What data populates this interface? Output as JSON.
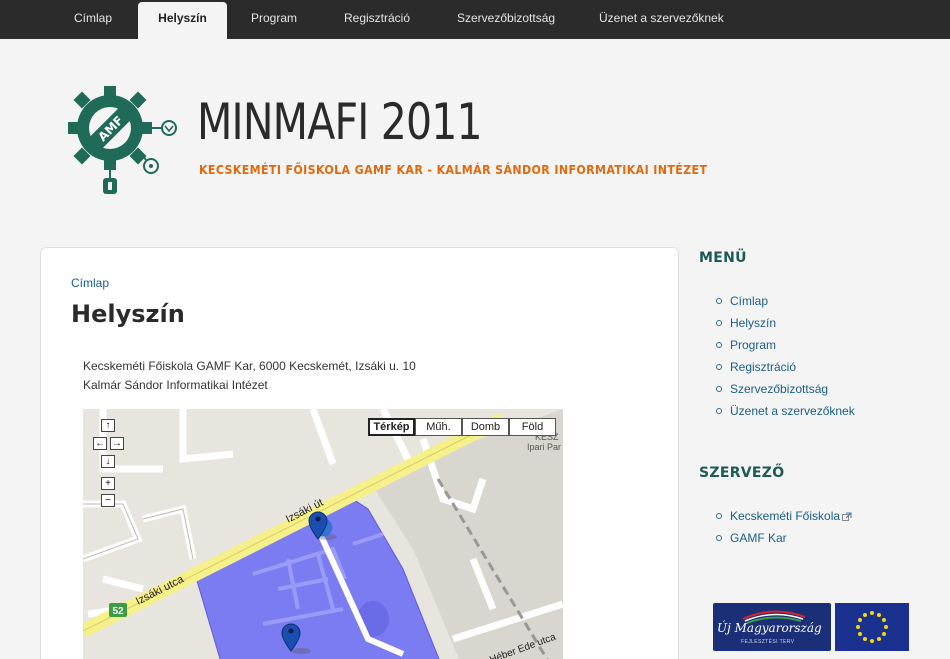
{
  "nav": {
    "tabs": [
      {
        "label": "Címlap"
      },
      {
        "label": "Helyszín",
        "active": true
      },
      {
        "label": "Program"
      },
      {
        "label": "Regisztráció"
      },
      {
        "label": "Szervezőbizottság"
      },
      {
        "label": "Üzenet a szervezőknek"
      }
    ]
  },
  "header": {
    "logo_text": "AMF",
    "title": "MINMAFI 2011",
    "slogan": "KECSKEMÉTI FŐISKOLA GAMF KAR - KALMÁR SÁNDOR INFORMATIKAI INTÉZET"
  },
  "content": {
    "breadcrumb": "Címlap",
    "page_title": "Helyszín",
    "address_line1": "Kecskeméti Főiskola GAMF Kar, 6000 Kecskemét, Izsáki u. 10",
    "address_line2": "Kalmár Sándor Informatikai Intézet"
  },
  "map": {
    "types": [
      "Térkép",
      "Műh.",
      "Domb",
      "Föld"
    ],
    "selected_type": "Térkép",
    "nav_icons": [
      "pan-up-icon",
      "pan-left-icon",
      "pan-right-icon",
      "pan-down-icon",
      "zoom-in-icon",
      "zoom-out-icon"
    ],
    "labels": {
      "road1": "Izsáki utca",
      "road2": "Izsáki út",
      "road3": "Héber Ede utca",
      "route": "52",
      "corner1": "KESZ",
      "corner2": "Ipari Par"
    }
  },
  "sidebar": {
    "menu_heading": "MENÜ",
    "menu_items": [
      {
        "label": "Címlap"
      },
      {
        "label": "Helyszín"
      },
      {
        "label": "Program"
      },
      {
        "label": "Regisztráció"
      },
      {
        "label": "Szervezőbizottság"
      },
      {
        "label": "Üzenet a szervezőknek"
      }
    ],
    "org_heading": "SZERVEZŐ",
    "org_items": [
      {
        "label": "Kecskeméti Főiskola",
        "external": true
      },
      {
        "label": "GAMF Kar"
      }
    ],
    "banner_text": "Új Magyarország",
    "banner_sub": "FEJLESZTÉSI TERV"
  },
  "colors": {
    "nav_bg": "#2b2b2b",
    "accent_orange": "#e06a0e",
    "logo_green": "#1f6b57",
    "link": "#1a5f88",
    "heading_green": "#1c5a55",
    "map_highlight": "#7b7cf2"
  }
}
